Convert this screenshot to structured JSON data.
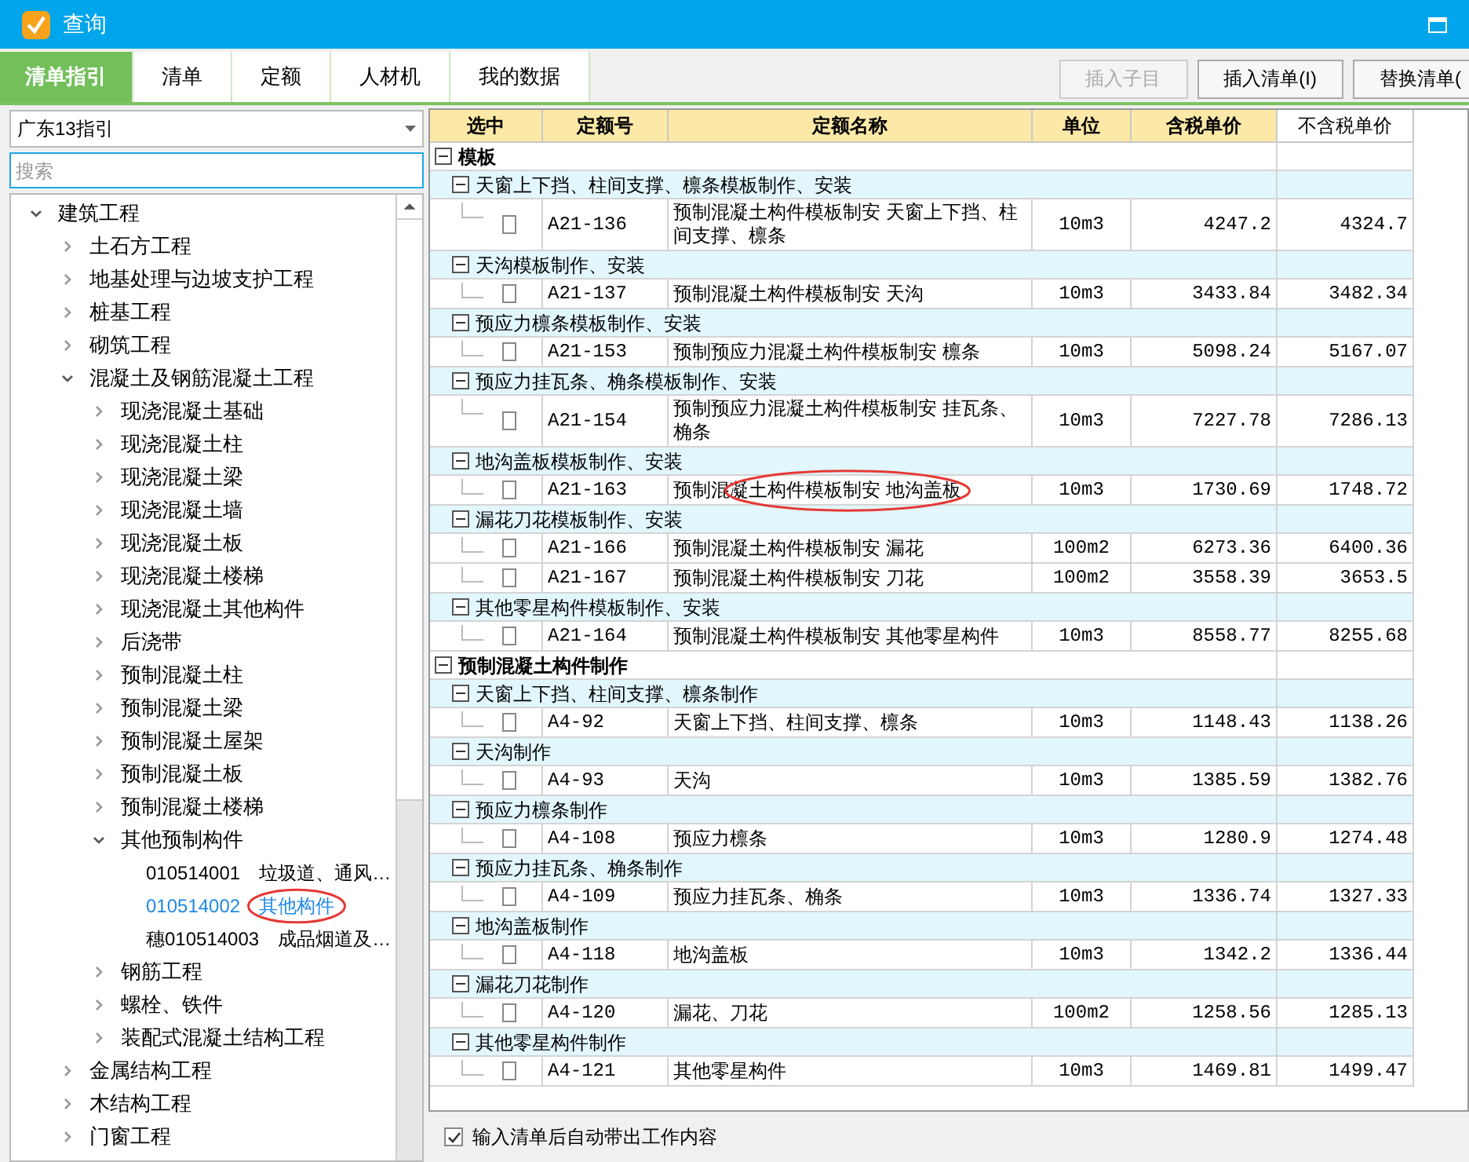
{
  "window": {
    "title": "查询"
  },
  "tabs": [
    {
      "label": "清单指引",
      "selected": true
    },
    {
      "label": "清单",
      "selected": false
    },
    {
      "label": "定额",
      "selected": false
    },
    {
      "label": "人材机",
      "selected": false
    },
    {
      "label": "我的数据",
      "selected": false
    }
  ],
  "toolbar_buttons": [
    {
      "label": "插入子目",
      "disabled": true
    },
    {
      "label": "插入清单(I)",
      "disabled": false
    },
    {
      "label": "替换清单(",
      "disabled": false
    }
  ],
  "guide_select": {
    "value": "广东13指引"
  },
  "search": {
    "placeholder": "搜索"
  },
  "tree": [
    {
      "label": "建筑工程",
      "expanded": true,
      "children": [
        {
          "label": "土石方工程",
          "expanded": false
        },
        {
          "label": "地基处理与边坡支护工程",
          "expanded": false
        },
        {
          "label": "桩基工程",
          "expanded": false
        },
        {
          "label": "砌筑工程",
          "expanded": false
        },
        {
          "label": "混凝土及钢筋混凝土工程",
          "expanded": true,
          "children": [
            {
              "label": "现浇混凝土基础",
              "expanded": false
            },
            {
              "label": "现浇混凝土柱",
              "expanded": false
            },
            {
              "label": "现浇混凝土梁",
              "expanded": false
            },
            {
              "label": "现浇混凝土墙",
              "expanded": false
            },
            {
              "label": "现浇混凝土板",
              "expanded": false
            },
            {
              "label": "现浇混凝土楼梯",
              "expanded": false
            },
            {
              "label": "现浇混凝土其他构件",
              "expanded": false
            },
            {
              "label": "后浇带",
              "expanded": false
            },
            {
              "label": "预制混凝土柱",
              "expanded": false
            },
            {
              "label": "预制混凝土梁",
              "expanded": false
            },
            {
              "label": "预制混凝土屋架",
              "expanded": false
            },
            {
              "label": "预制混凝土板",
              "expanded": false
            },
            {
              "label": "预制混凝土楼梯",
              "expanded": false
            },
            {
              "label": "其他预制构件",
              "expanded": true,
              "children": [
                {
                  "kind": "leaf",
                  "code": "010514001",
                  "label": "垃圾道、通风…",
                  "selected": false,
                  "circled": false
                },
                {
                  "kind": "leaf",
                  "code": "010514002",
                  "label": "其他构件",
                  "selected": true,
                  "circled": true
                },
                {
                  "kind": "leaf",
                  "code": "穗010514003",
                  "label": "成品烟道及…",
                  "selected": false,
                  "circled": false
                }
              ]
            },
            {
              "label": "钢筋工程",
              "expanded": false
            },
            {
              "label": "螺栓、铁件",
              "expanded": false
            },
            {
              "label": "装配式混凝土结构工程",
              "expanded": false
            }
          ]
        },
        {
          "label": "金属结构工程",
          "expanded": false
        },
        {
          "label": "木结构工程",
          "expanded": false
        },
        {
          "label": "门窗工程",
          "expanded": false
        }
      ]
    }
  ],
  "table": {
    "columns": [
      "选中",
      "定额号",
      "定额名称",
      "单位",
      "含税单价",
      "不含税单价"
    ],
    "sections": [
      {
        "title": "模板",
        "expanded": true,
        "groups": [
          {
            "title": "天窗上下挡、柱间支撑、檩条模板制作、安装",
            "expanded": true,
            "rows": [
              {
                "checked": false,
                "code": "A21-136",
                "name": "预制混凝土构件模板制安 天窗上下挡、柱间支撑、檩条",
                "unit": "10m3",
                "price_tax": "4247.2",
                "price_notax": "4324.7",
                "circled": false
              }
            ]
          },
          {
            "title": "天沟模板制作、安装",
            "expanded": true,
            "rows": [
              {
                "checked": false,
                "code": "A21-137",
                "name": "预制混凝土构件模板制安 天沟",
                "unit": "10m3",
                "price_tax": "3433.84",
                "price_notax": "3482.34",
                "circled": false
              }
            ]
          },
          {
            "title": "预应力檩条模板制作、安装",
            "expanded": true,
            "rows": [
              {
                "checked": false,
                "code": "A21-153",
                "name": "预制预应力混凝土构件模板制安 檩条",
                "unit": "10m3",
                "price_tax": "5098.24",
                "price_notax": "5167.07",
                "circled": false
              }
            ]
          },
          {
            "title": "预应力挂瓦条、桷条模板制作、安装",
            "expanded": true,
            "rows": [
              {
                "checked": false,
                "code": "A21-154",
                "name": "预制预应力混凝土构件模板制安 挂瓦条、桷条",
                "unit": "10m3",
                "price_tax": "7227.78",
                "price_notax": "7286.13",
                "circled": false
              }
            ]
          },
          {
            "title": "地沟盖板模板制作、安装",
            "expanded": true,
            "rows": [
              {
                "checked": false,
                "code": "A21-163",
                "name": "预制混凝土构件模板制安 地沟盖板",
                "unit": "10m3",
                "price_tax": "1730.69",
                "price_notax": "1748.72",
                "circled": true
              }
            ]
          },
          {
            "title": "漏花刀花模板制作、安装",
            "expanded": true,
            "rows": [
              {
                "checked": false,
                "code": "A21-166",
                "name": "预制混凝土构件模板制安 漏花",
                "unit": "100m2",
                "price_tax": "6273.36",
                "price_notax": "6400.36",
                "circled": false
              },
              {
                "checked": false,
                "code": "A21-167",
                "name": "预制混凝土构件模板制安 刀花",
                "unit": "100m2",
                "price_tax": "3558.39",
                "price_notax": "3653.5",
                "circled": false
              }
            ]
          },
          {
            "title": "其他零星构件模板制作、安装",
            "expanded": true,
            "rows": [
              {
                "checked": false,
                "code": "A21-164",
                "name": "预制混凝土构件模板制安 其他零星构件",
                "unit": "10m3",
                "price_tax": "8558.77",
                "price_notax": "8255.68",
                "circled": false
              }
            ]
          }
        ]
      },
      {
        "title": "预制混凝土构件制作",
        "expanded": true,
        "groups": [
          {
            "title": "天窗上下挡、柱间支撑、檩条制作",
            "expanded": true,
            "rows": [
              {
                "checked": false,
                "code": "A4-92",
                "name": "天窗上下挡、柱间支撑、檩条",
                "unit": "10m3",
                "price_tax": "1148.43",
                "price_notax": "1138.26",
                "circled": false
              }
            ]
          },
          {
            "title": "天沟制作",
            "expanded": true,
            "rows": [
              {
                "checked": false,
                "code": "A4-93",
                "name": "天沟",
                "unit": "10m3",
                "price_tax": "1385.59",
                "price_notax": "1382.76",
                "circled": false
              }
            ]
          },
          {
            "title": "预应力檩条制作",
            "expanded": true,
            "rows": [
              {
                "checked": false,
                "code": "A4-108",
                "name": "预应力檩条",
                "unit": "10m3",
                "price_tax": "1280.9",
                "price_notax": "1274.48",
                "circled": false
              }
            ]
          },
          {
            "title": "预应力挂瓦条、桷条制作",
            "expanded": true,
            "rows": [
              {
                "checked": false,
                "code": "A4-109",
                "name": "预应力挂瓦条、桷条",
                "unit": "10m3",
                "price_tax": "1336.74",
                "price_notax": "1327.33",
                "circled": false
              }
            ]
          },
          {
            "title": "地沟盖板制作",
            "expanded": true,
            "rows": [
              {
                "checked": false,
                "code": "A4-118",
                "name": "地沟盖板",
                "unit": "10m3",
                "price_tax": "1342.2",
                "price_notax": "1336.44",
                "circled": false
              }
            ]
          },
          {
            "title": "漏花刀花制作",
            "expanded": true,
            "rows": [
              {
                "checked": false,
                "code": "A4-120",
                "name": "漏花、刀花",
                "unit": "100m2",
                "price_tax": "1258.56",
                "price_notax": "1285.13",
                "circled": false
              }
            ]
          },
          {
            "title": "其他零星构件制作",
            "expanded": true,
            "rows": [
              {
                "checked": false,
                "code": "A4-121",
                "name": "其他零星构件",
                "unit": "10m3",
                "price_tax": "1469.81",
                "price_notax": "1499.47",
                "circled": false
              }
            ]
          }
        ]
      }
    ]
  },
  "footer": {
    "auto_content": {
      "label": "输入清单后自动带出工作内容",
      "checked": true
    }
  }
}
